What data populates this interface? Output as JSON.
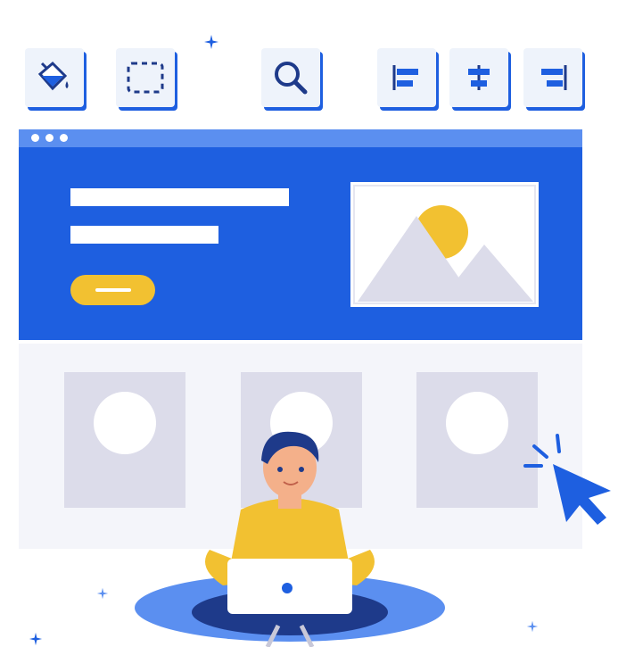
{
  "colors": {
    "primary_blue": "#1e5fe0",
    "light_blue": "#5b8ff0",
    "accent_yellow": "#f2c131",
    "placeholder_grey": "#dcdcea",
    "background": "#ffffff"
  },
  "toolbar": {
    "tools": [
      {
        "icon": "paint-bucket-icon"
      },
      {
        "icon": "selection-marquee-icon"
      },
      {
        "icon": "search-icon"
      },
      {
        "icon": "align-left-icon"
      },
      {
        "icon": "align-center-icon"
      },
      {
        "icon": "align-right-icon"
      }
    ]
  },
  "hero": {
    "image_icon": "image-placeholder-icon"
  },
  "cursor": {
    "icon": "pointer-cursor-icon"
  }
}
